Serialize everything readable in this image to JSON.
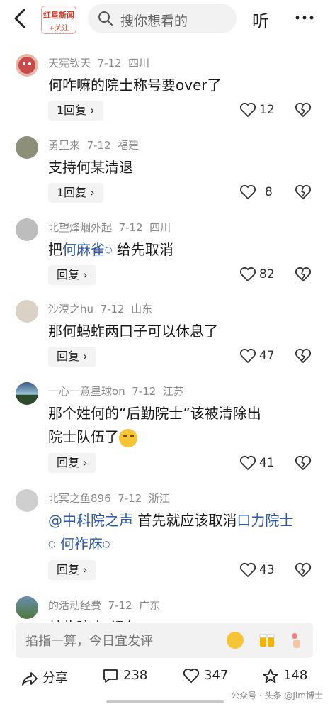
{
  "header": {
    "logo_line1": "红星新闻",
    "logo_line2": "+关注",
    "search_placeholder": "搜你想看的",
    "listen_label": "听"
  },
  "comments": [
    {
      "user": "天宪钦天",
      "date": "7-12",
      "location": "四川",
      "text": "何咋嘛的院士称号要over了",
      "reply_label": "1回复",
      "likes": "12"
    },
    {
      "user": "勇里来",
      "date": "7-12",
      "location": "福建",
      "text": "支持何某清退",
      "reply_label": "1回复",
      "likes": "8"
    },
    {
      "user": "北望烽烟外起",
      "date": "7-12",
      "location": "四川",
      "text_prefix": "把",
      "link": "何麻雀",
      "text_suffix": "给先取消",
      "reply_label": "回复",
      "likes": "82"
    },
    {
      "user": "沙漠之hu",
      "date": "7-12",
      "location": "山东",
      "text": "那何蚂蚱两口子可以休息了",
      "reply_label": "回复",
      "likes": "47"
    },
    {
      "user": "一心一意星球on",
      "date": "7-12",
      "location": "江苏",
      "text_line1": "那个姓何的“后勤院士”该被清除出",
      "text_line2": "院士队伍了",
      "reply_label": "回复",
      "likes": "41"
    },
    {
      "user": "北冥之鱼896",
      "date": "7-12",
      "location": "浙江",
      "mention": "@中科院之声",
      "text_mid": "首先就应该取消",
      "link1": "口力院士",
      "link2": "何祚庥",
      "reply_label": "回复",
      "likes": "43"
    },
    {
      "user": "的活动经费",
      "date": "7-12",
      "location": "广东",
      "text": "某些院士 都有"
    }
  ],
  "input": {
    "placeholder": "掐指一算，今日宜发评"
  },
  "bottom": {
    "share_label": "分享",
    "comment_count": "238",
    "like_count": "347",
    "star_count": "148"
  },
  "watermark": "公众号 · 头条 @Jim博士",
  "colors": {
    "link": "#2f5aa6",
    "logo_red": "#d23a2a"
  },
  "icons": [
    "back-icon",
    "search-icon",
    "more-icon",
    "heart-icon",
    "dislike-icon",
    "share-icon",
    "comment-icon",
    "star-icon"
  ]
}
